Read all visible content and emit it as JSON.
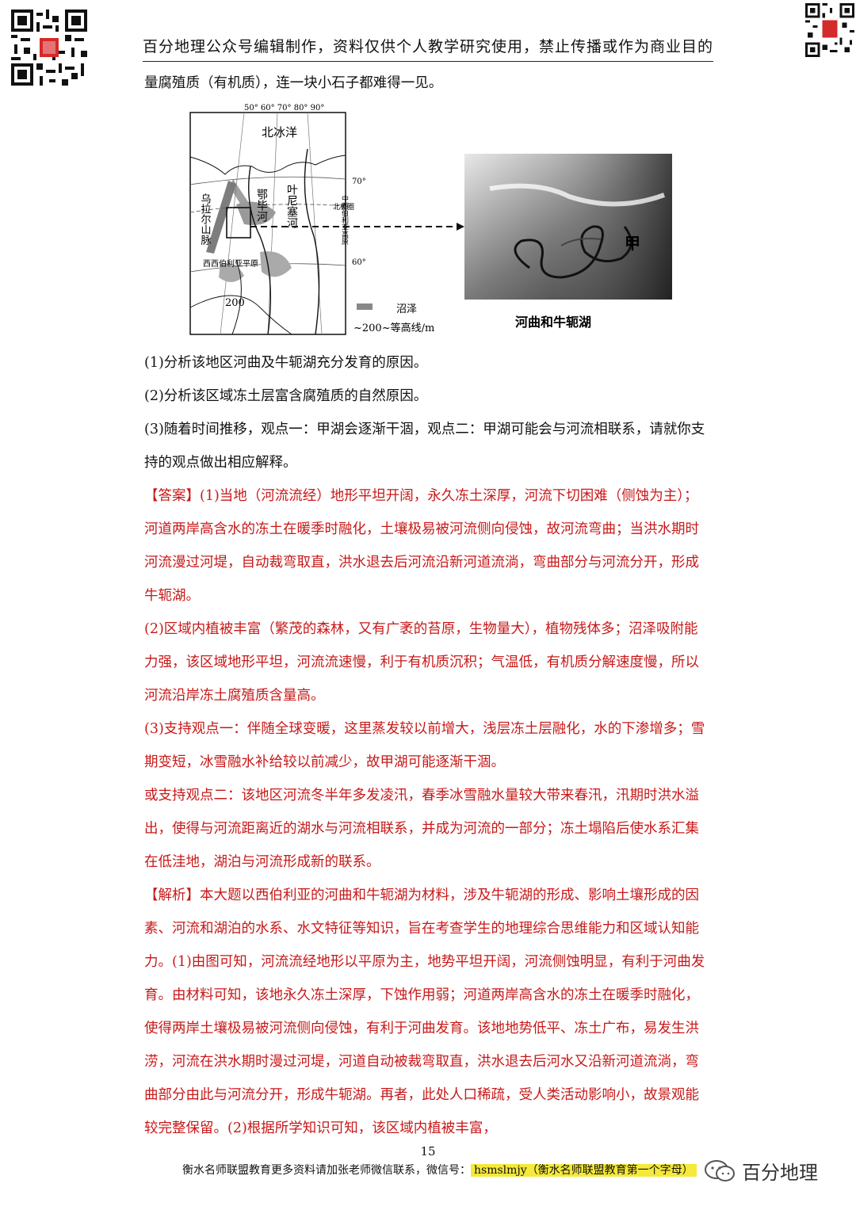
{
  "header": {
    "text": "百分地理公众号编辑制作，资料仅供个人教学研究使用，禁止传播或作为商业目的"
  },
  "intro": {
    "text": "量腐殖质（有机质），连一块小石子都难得一见。"
  },
  "figure": {
    "map": {
      "lon_labels": "50° 60° 70° 80° 90°",
      "ocean": "北冰洋",
      "lat_70": "70°",
      "lat_60": "60°",
      "arctic_circle": "北极圈",
      "plateau": "中西伯利亚高原",
      "mountains": "乌拉尔山脉",
      "river1": "叶尼塞河",
      "river2": "鄂毕河",
      "plain": "西西伯利亚平原",
      "contour_value": "200",
      "legend_swamp": "沼泽",
      "legend_contour": "~200~等高线/m"
    },
    "photo": {
      "label_jia": "甲",
      "caption": "河曲和牛轭湖"
    }
  },
  "questions": [
    "(1)分析该地区河曲及牛轭湖充分发育的原因。",
    "(2)分析该区域冻土层富含腐殖质的自然原因。",
    "(3)随着时间推移，观点一：甲湖会逐渐干涸，观点二：甲湖可能会与河流相联系，请就你支持的观点做出相应解释。"
  ],
  "answer": {
    "p1": "【答案】(1)当地（河流流经）地形平坦开阔，永久冻土深厚，河流下切困难（侧蚀为主）；河道两岸高含水的冻土在暖季时融化，土壤极易被河流侧向侵蚀，故河流弯曲；当洪水期时河流漫过河堤，自动裁弯取直，洪水退去后河流沿新河道流淌，弯曲部分与河流分开，形成牛轭湖。",
    "p2": "(2)区域内植被丰富（繁茂的森林，又有广袤的苔原，生物量大），植物残体多；沼泽吸附能力强，该区域地形平坦，河流流速慢，利于有机质沉积；气温低，有机质分解速度慢，所以河流沿岸冻土腐殖质含量高。",
    "p3": "(3)支持观点一：伴随全球变暖，这里蒸发较以前增大，浅层冻土层融化，水的下渗增多；雪期变短，冰雪融水补给较以前减少，故甲湖可能逐渐干涸。",
    "p4": "或支持观点二：该地区河流冬半年多发凌汛，春季冰雪融水量较大带来春汛，汛期时洪水溢出，使得与河流距离近的湖水与河流相联系，并成为河流的一部分；冻土塌陷后使水系汇集在低洼地，湖泊与河流形成新的联系。"
  },
  "analysis": {
    "text": "【解析】本大题以西伯利亚的河曲和牛轭湖为材料，涉及牛轭湖的形成、影响土壤形成的因素、河流和湖泊的水系、水文特征等知识，旨在考查学生的地理综合思维能力和区域认知能力。(1)由图可知，河流流经地形以平原为主，地势平坦开阔，河流侧蚀明显，有利于河曲发育。由材料可知，该地永久冻土深厚，下蚀作用弱；河道两岸高含水的冻土在暖季时融化，使得两岸土壤极易被河流侧向侵蚀，有利于河曲发育。该地地势低平、冻土广布，易发生洪涝，河流在洪水期时漫过河堤，河道自动被裁弯取直，洪水退去后河水又沿新河道流淌，弯曲部分由此与河流分开，形成牛轭湖。再者，此处人口稀疏，受人类活动影响小，故景观能较完整保留。(2)根据所学知识可知，该区域内植被丰富，"
  },
  "footer": {
    "page_number": "15",
    "text": "衡水名师联盟教育更多资料请加张老师微信联系，微信号：",
    "wechat": "hsmslmjy（衡水名师联盟教育第一个字母）",
    "brand": "百分地理"
  }
}
